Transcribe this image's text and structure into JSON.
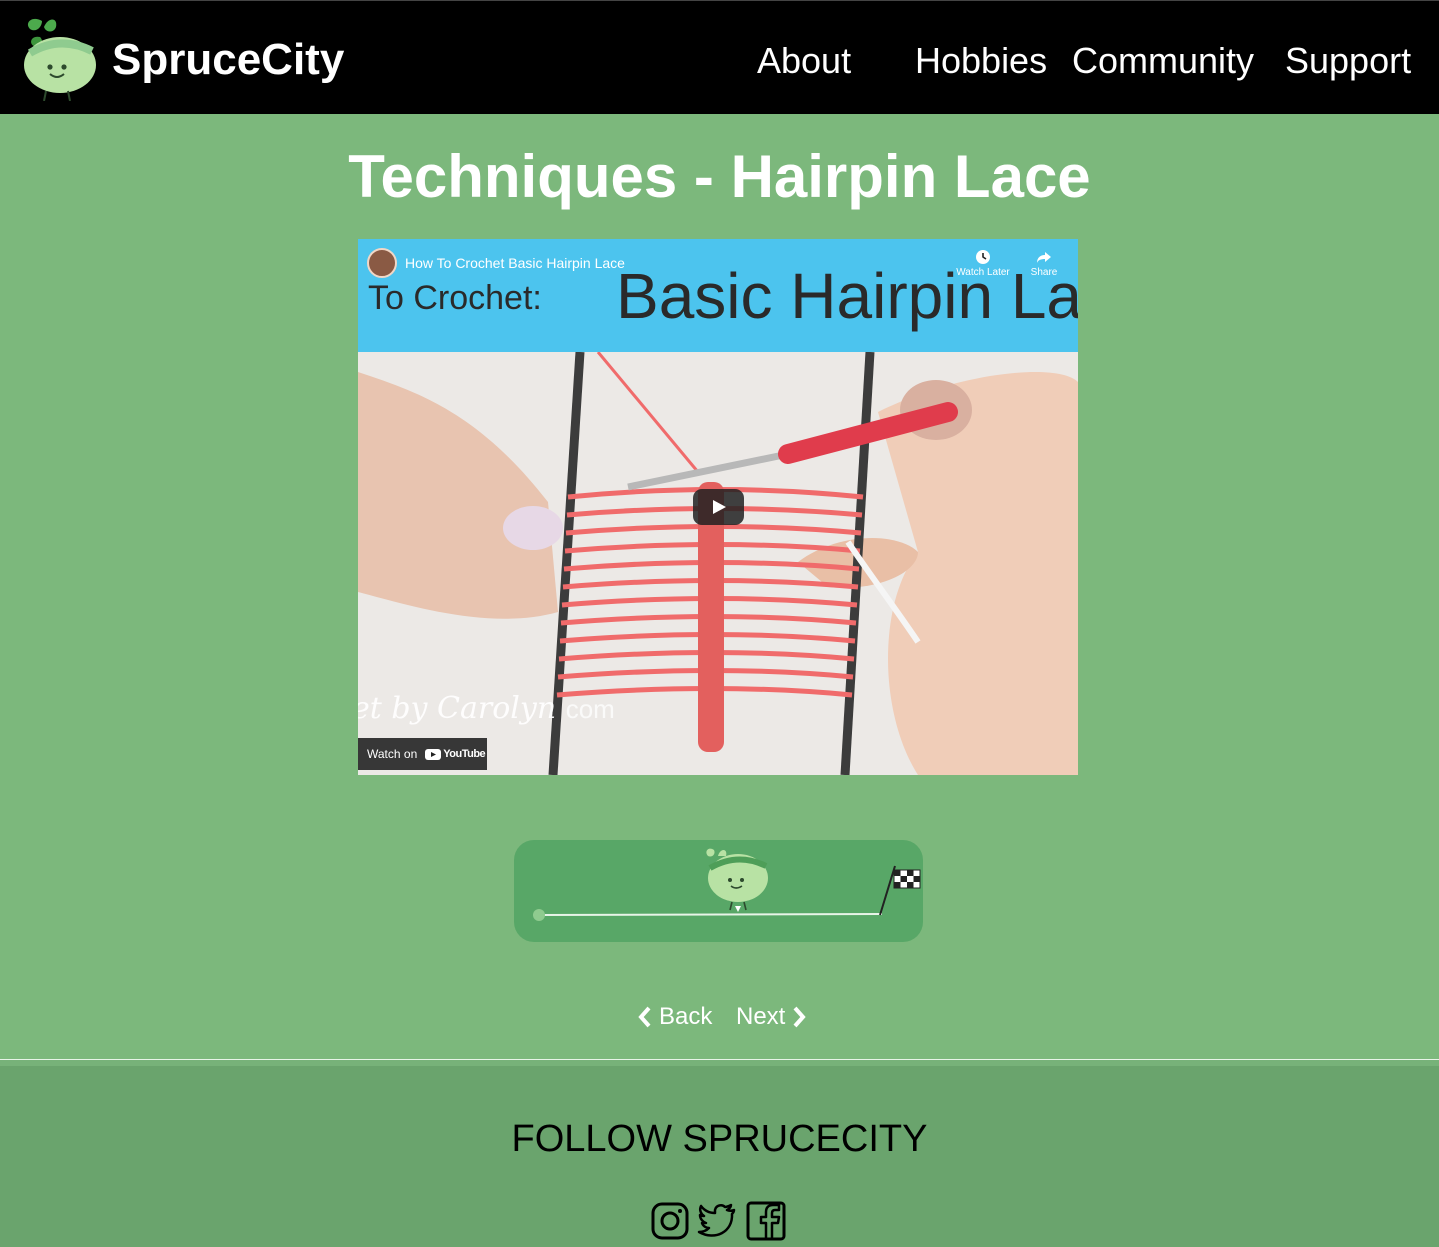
{
  "header": {
    "brand": "SpruceCity",
    "nav": [
      {
        "label": "About"
      },
      {
        "label": "Hobbies"
      },
      {
        "label": "Community"
      },
      {
        "label": "Support"
      }
    ]
  },
  "main": {
    "title": "Techniques - Hairpin Lace",
    "video": {
      "title": "How To Crochet Basic Hairpin Lace",
      "banner_small": "To Crochet:",
      "banner_big": "Basic Hairpin La",
      "watch_later_label": "Watch Later",
      "share_label": "Share",
      "credit": "et by Carolyn",
      "credit_site": "com",
      "watch_on_label": "Watch on",
      "youtube_label": "YouTube"
    },
    "progress": {
      "value": 0.5,
      "icons": [
        "mascot-icon",
        "checkered-flag-icon"
      ]
    },
    "pager": {
      "back": "Back",
      "next": "Next"
    }
  },
  "footer": {
    "title": "FOLLOW SPRUCECITY",
    "social": [
      "instagram-icon",
      "twitter-icon",
      "facebook-icon"
    ]
  },
  "colors": {
    "header_bg": "#000000",
    "page_bg": "#7cb87c",
    "progress_bg": "#58a767",
    "footer_bg": "#6aa46d",
    "video_banner": "#4cc4ee",
    "yarn": "#f06b6b"
  }
}
